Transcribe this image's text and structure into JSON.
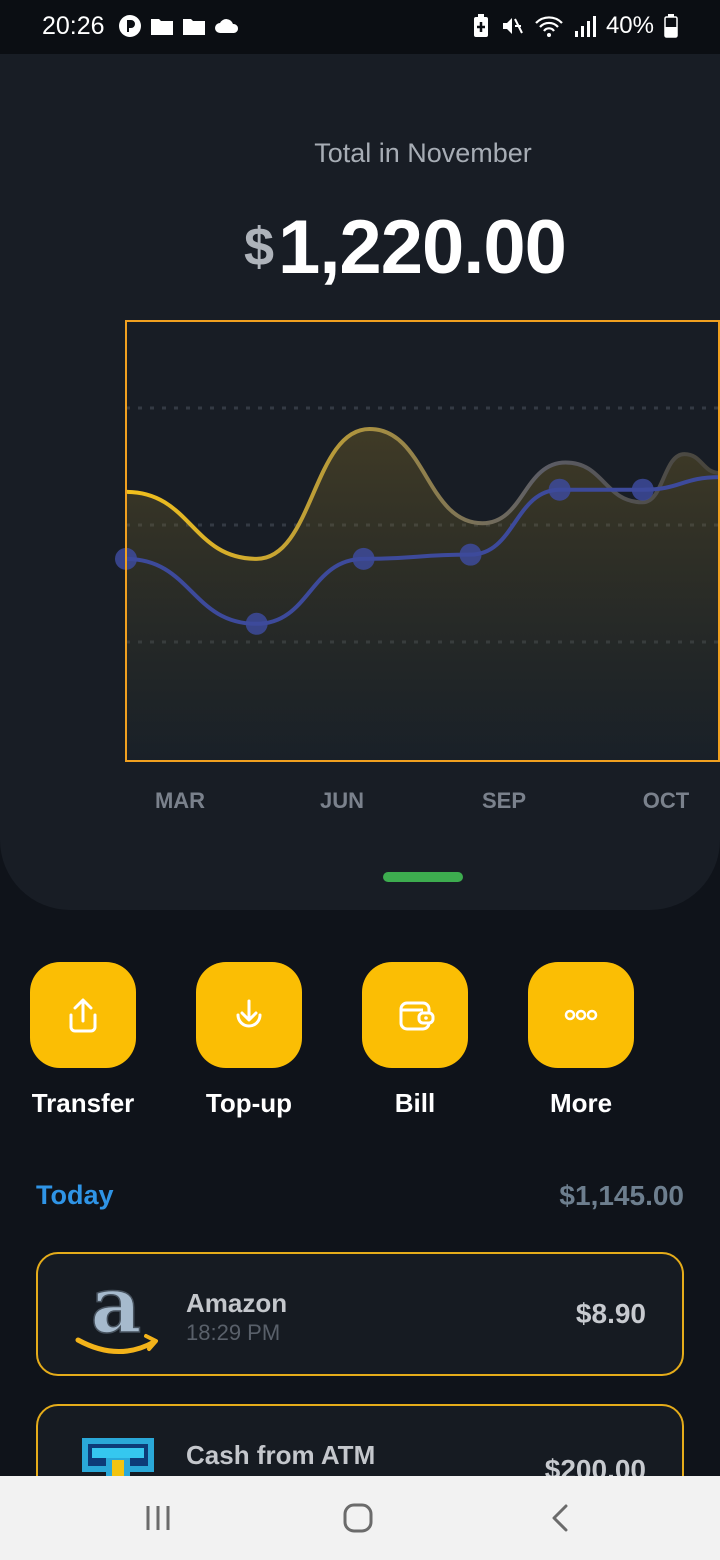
{
  "status_bar": {
    "time": "20:26",
    "battery": "40%",
    "left_icons": [
      "app-notification-icon",
      "folder-icon",
      "folder-icon",
      "cloud-icon"
    ],
    "right_icons": [
      "battery-saver-icon",
      "mute-icon",
      "wifi-icon",
      "signal-icon",
      "battery-icon"
    ]
  },
  "summary": {
    "label": "Total in November",
    "currency": "$",
    "amount": "1,220.00"
  },
  "chart_data": {
    "type": "line",
    "categories": [
      "MAR",
      "JUN",
      "SEP",
      "OCT"
    ],
    "series": [
      {
        "color": "#e9b81c",
        "values": [
          68,
          36,
          98,
          53,
          82,
          63,
          86,
          77
        ]
      },
      {
        "color": "#3d4a9b",
        "values": [
          36,
          5,
          36,
          38,
          69,
          69,
          75
        ]
      }
    ],
    "ylim": [
      -60,
      150
    ],
    "grid": true,
    "accent_color": "#f0a020"
  },
  "actions": [
    {
      "label": "Transfer",
      "icon": "upload-icon"
    },
    {
      "label": "Top-up",
      "icon": "download-icon"
    },
    {
      "label": "Bill",
      "icon": "wallet-icon"
    },
    {
      "label": "More",
      "icon": "more-icon"
    }
  ],
  "today": {
    "label": "Today",
    "total": "$1,145.00"
  },
  "transactions": [
    {
      "name": "Amazon",
      "time": "18:29 PM",
      "amount": "$8.90",
      "icon": "amazon-logo"
    },
    {
      "name": "Cash from ATM",
      "time": "",
      "amount": "$200.00",
      "icon": "atm-icon"
    }
  ],
  "nav": {
    "icons": [
      "recent-apps-icon",
      "home-icon",
      "back-icon"
    ]
  },
  "colors": {
    "background": "#0f131a",
    "card": "#181d25",
    "accent_yellow": "#fbbe04",
    "today_blue": "#2f94e6",
    "handle_green": "#3dac4f"
  }
}
